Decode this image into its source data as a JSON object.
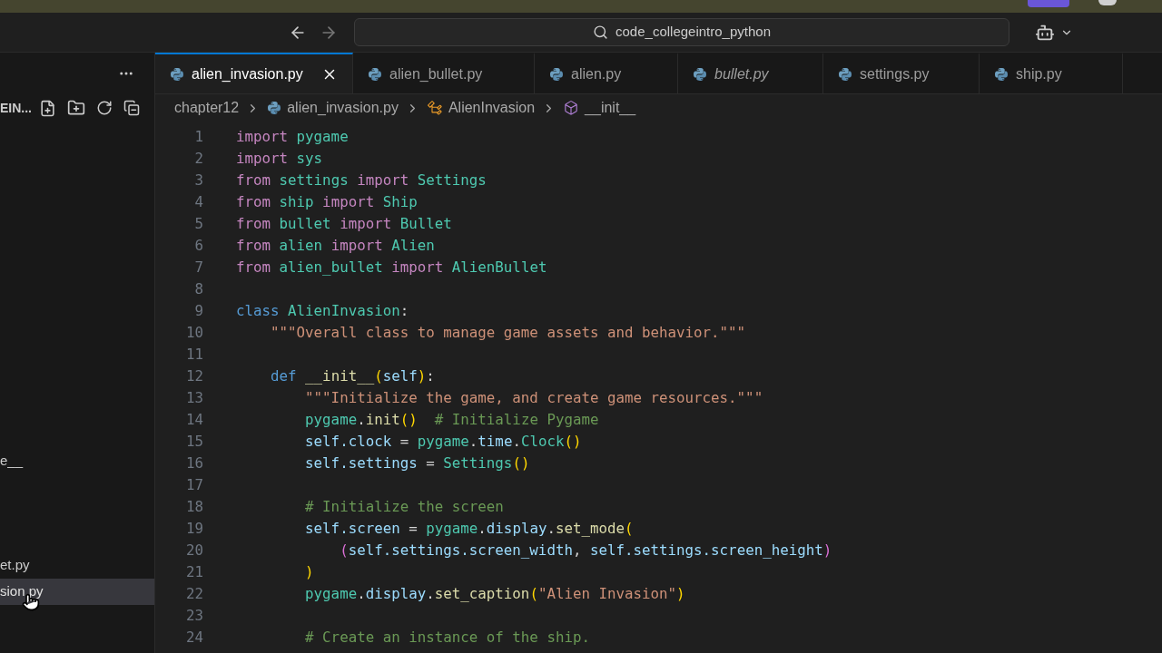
{
  "title_bar": {
    "search": "code_collegeintro_python"
  },
  "sidebar": {
    "header": "EIN...",
    "items": [
      {
        "label": "e__",
        "selected": false
      },
      {
        "label": "et.py",
        "selected": false
      },
      {
        "label": "sion.py",
        "selected": true
      }
    ]
  },
  "tabs": [
    {
      "label": "alien_invasion.py",
      "selected": true,
      "preview": false
    },
    {
      "label": "alien_bullet.py",
      "selected": false,
      "preview": false
    },
    {
      "label": "alien.py",
      "selected": false,
      "preview": false
    },
    {
      "label": "bullet.py",
      "selected": false,
      "preview": true
    },
    {
      "label": "settings.py",
      "selected": false,
      "preview": false
    },
    {
      "label": "ship.py",
      "selected": false,
      "preview": false
    }
  ],
  "breadcrumbs": [
    {
      "kind": "folder",
      "label": "chapter12"
    },
    {
      "kind": "file",
      "label": "alien_invasion.py"
    },
    {
      "kind": "class",
      "label": "AlienInvasion"
    },
    {
      "kind": "method",
      "label": "__init__"
    }
  ],
  "code": [
    {
      "number": "1",
      "tokens": [
        {
          "kind": "keyword",
          "text": "import "
        },
        {
          "kind": "class",
          "text": "pygame"
        }
      ]
    },
    {
      "number": "2",
      "tokens": [
        {
          "kind": "keyword",
          "text": "import "
        },
        {
          "kind": "class",
          "text": "sys"
        }
      ]
    },
    {
      "number": "3",
      "tokens": [
        {
          "kind": "keyword",
          "text": "from "
        },
        {
          "kind": "class",
          "text": "settings"
        },
        {
          "kind": "keyword",
          "text": " import "
        },
        {
          "kind": "class",
          "text": "Settings"
        }
      ]
    },
    {
      "number": "4",
      "tokens": [
        {
          "kind": "keyword",
          "text": "from "
        },
        {
          "kind": "class",
          "text": "ship"
        },
        {
          "kind": "keyword",
          "text": " import "
        },
        {
          "kind": "class",
          "text": "Ship"
        }
      ]
    },
    {
      "number": "5",
      "tokens": [
        {
          "kind": "keyword",
          "text": "from "
        },
        {
          "kind": "class",
          "text": "bullet"
        },
        {
          "kind": "keyword",
          "text": " import "
        },
        {
          "kind": "class",
          "text": "Bullet"
        }
      ]
    },
    {
      "number": "6",
      "tokens": [
        {
          "kind": "keyword",
          "text": "from "
        },
        {
          "kind": "class",
          "text": "alien"
        },
        {
          "kind": "keyword",
          "text": " import "
        },
        {
          "kind": "class",
          "text": "Alien"
        }
      ]
    },
    {
      "number": "7",
      "tokens": [
        {
          "kind": "keyword",
          "text": "from "
        },
        {
          "kind": "class",
          "text": "alien_bullet"
        },
        {
          "kind": "keyword",
          "text": " import "
        },
        {
          "kind": "class",
          "text": "AlienBullet"
        }
      ]
    },
    {
      "number": "8"
    },
    {
      "number": "9",
      "tokens": [
        {
          "kind": "storage",
          "text": "class "
        },
        {
          "kind": "class",
          "text": "AlienInvasion"
        },
        {
          "kind": "plain",
          "text": ":"
        }
      ]
    },
    {
      "number": "10",
      "tokens": [
        {
          "kind": "string",
          "text": "    \"\"\"Overall class to manage game assets and behavior.\"\"\""
        }
      ]
    },
    {
      "number": "11"
    },
    {
      "number": "12",
      "tokens": [
        {
          "kind": "storage",
          "text": "    def "
        },
        {
          "kind": "function",
          "text": "__init__"
        },
        {
          "kind": "bracket",
          "text": "("
        },
        {
          "kind": "variable",
          "text": "self"
        },
        {
          "kind": "bracket",
          "text": ")"
        },
        {
          "kind": "plain",
          "text": ":"
        }
      ]
    },
    {
      "number": "13",
      "tokens": [
        {
          "kind": "string",
          "text": "        \"\"\"Initialize the game, and create game resources.\"\"\""
        }
      ]
    },
    {
      "number": "14",
      "tokens": [
        {
          "kind": "class",
          "text": "        pygame"
        },
        {
          "kind": "plain",
          "text": "."
        },
        {
          "kind": "function",
          "text": "init"
        },
        {
          "kind": "bracket",
          "text": "()"
        },
        {
          "kind": "comment",
          "text": "  # Initialize Pygame"
        }
      ]
    },
    {
      "number": "15",
      "tokens": [
        {
          "kind": "variable",
          "text": "        self.clock"
        },
        {
          "kind": "plain",
          "text": " = "
        },
        {
          "kind": "class",
          "text": "pygame"
        },
        {
          "kind": "plain",
          "text": "."
        },
        {
          "kind": "variable",
          "text": "time"
        },
        {
          "kind": "plain",
          "text": "."
        },
        {
          "kind": "class",
          "text": "Clock"
        },
        {
          "kind": "bracket",
          "text": "()"
        }
      ]
    },
    {
      "number": "16",
      "tokens": [
        {
          "kind": "variable",
          "text": "        self.settings"
        },
        {
          "kind": "plain",
          "text": " = "
        },
        {
          "kind": "class",
          "text": "Settings"
        },
        {
          "kind": "bracket",
          "text": "()"
        }
      ]
    },
    {
      "number": "17"
    },
    {
      "number": "18",
      "tokens": [
        {
          "kind": "comment",
          "text": "        # Initialize the screen"
        }
      ]
    },
    {
      "number": "19",
      "tokens": [
        {
          "kind": "variable",
          "text": "        self.screen"
        },
        {
          "kind": "plain",
          "text": " = "
        },
        {
          "kind": "class",
          "text": "pygame"
        },
        {
          "kind": "plain",
          "text": "."
        },
        {
          "kind": "variable",
          "text": "display"
        },
        {
          "kind": "plain",
          "text": "."
        },
        {
          "kind": "function",
          "text": "set_mode"
        },
        {
          "kind": "bracket",
          "text": "("
        }
      ]
    },
    {
      "number": "20",
      "tokens": [
        {
          "kind": "bracket2",
          "text": "            ("
        },
        {
          "kind": "variable",
          "text": "self.settings.screen_width"
        },
        {
          "kind": "plain",
          "text": ", "
        },
        {
          "kind": "variable",
          "text": "self.settings.screen_height"
        },
        {
          "kind": "bracket2",
          "text": ")"
        }
      ]
    },
    {
      "number": "21",
      "tokens": [
        {
          "kind": "bracket",
          "text": "        )"
        }
      ]
    },
    {
      "number": "22",
      "tokens": [
        {
          "kind": "class",
          "text": "        pygame"
        },
        {
          "kind": "plain",
          "text": "."
        },
        {
          "kind": "variable",
          "text": "display"
        },
        {
          "kind": "plain",
          "text": "."
        },
        {
          "kind": "function",
          "text": "set_caption"
        },
        {
          "kind": "bracket",
          "text": "("
        },
        {
          "kind": "string",
          "text": "\"Alien Invasion\""
        },
        {
          "kind": "bracket",
          "text": ")"
        }
      ]
    },
    {
      "number": "23"
    },
    {
      "number": "24",
      "tokens": [
        {
          "kind": "comment",
          "text": "        # Create an instance of the ship."
        }
      ]
    }
  ]
}
